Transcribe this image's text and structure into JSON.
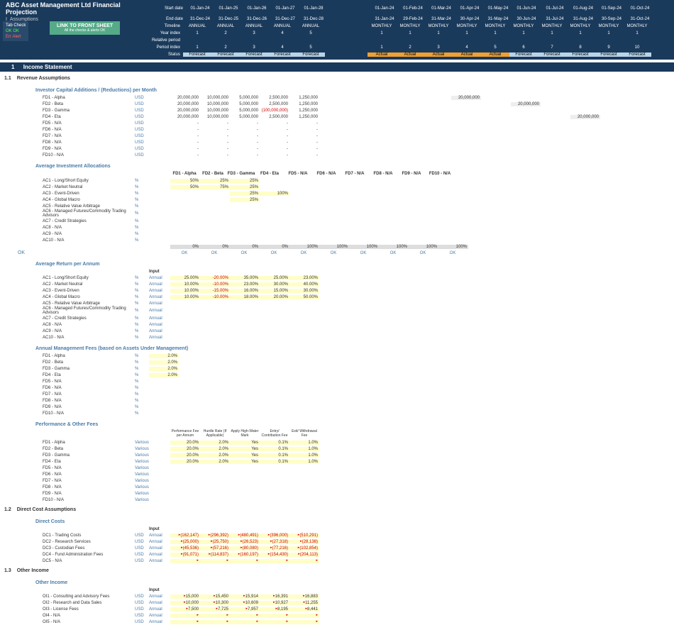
{
  "header": {
    "title": "ABC Asset Management Ltd Financial Projection",
    "subtitle": "I_Assumptions",
    "rows": [
      {
        "label": "Start date",
        "annual": [
          "01-Jan-24",
          "01-Jan-25",
          "01-Jan-26",
          "01-Jan-27",
          "01-Jan-28"
        ],
        "monthly": [
          "01-Jan-24",
          "01-Feb-24",
          "01-Mar-24",
          "01-Apr-24",
          "01-May-24",
          "01-Jun-24",
          "01-Jul-24",
          "01-Aug-24",
          "01-Sep-24",
          "01-Oct-24"
        ]
      },
      {
        "label": "End date",
        "annual": [
          "31-Dec-24",
          "31-Dec-25",
          "31-Dec-26",
          "31-Dec-27",
          "31-Dec-28"
        ],
        "monthly": [
          "31-Jan-24",
          "29-Feb-24",
          "31-Mar-24",
          "30-Apr-24",
          "31-May-24",
          "30-Jun-24",
          "31-Jul-24",
          "31-Aug-24",
          "30-Sep-24",
          "31-Oct-24"
        ]
      },
      {
        "label": "Timeline",
        "annual": [
          "ANNUAL",
          "ANNUAL",
          "ANNUAL",
          "ANNUAL",
          "ANNUAL"
        ],
        "monthly": [
          "MONTHLY",
          "MONTHLY",
          "MONTHLY",
          "MONTHLY",
          "MONTHLY",
          "MONTHLY",
          "MONTHLY",
          "MONTHLY",
          "MONTHLY",
          "MONTHLY"
        ]
      },
      {
        "label": "Year index",
        "annual": [
          "1",
          "2",
          "3",
          "4",
          "5"
        ],
        "monthly": [
          "1",
          "1",
          "1",
          "1",
          "1",
          "1",
          "1",
          "1",
          "1",
          "1"
        ]
      },
      {
        "label": "Relative period",
        "annual": [
          "",
          "",
          "",
          "",
          ""
        ],
        "monthly": [
          "",
          "",
          "",
          "",
          "",
          "",
          "",
          "",
          "",
          ""
        ]
      },
      {
        "label": "Period index",
        "annual": [
          "1",
          "2",
          "3",
          "4",
          "5"
        ],
        "monthly": [
          "1",
          "2",
          "3",
          "4",
          "5",
          "6",
          "7",
          "8",
          "9",
          "10"
        ]
      },
      {
        "label": "Status",
        "annual": [
          "Forecast",
          "Forecast",
          "Forecast",
          "Forecast",
          "Forecast"
        ],
        "monthly": [
          "Actual",
          "Actual",
          "Actual",
          "Actual",
          "Actual",
          "Forecast",
          "Forecast",
          "Forecast",
          "Forecast",
          "Forecast"
        ],
        "status": true
      }
    ]
  },
  "tabcheck": {
    "title": "Tab Check",
    "ok_lbl": "OK",
    "ok_val": "OK",
    "err_lbl": "Err",
    "err_val": "Alert"
  },
  "linkbtn": {
    "main": "LINK TO FRONT SHEET",
    "sub": "All the checks & alerts OK"
  },
  "sec1": {
    "num": "1",
    "title": "Income Statement"
  },
  "sec11": {
    "num": "1.1",
    "title": "Revenue Assumptions"
  },
  "grp_invcap": {
    "title": "Investor Capital Additions / (Reductions) per Month"
  },
  "invcap_rows": [
    {
      "lbl": "FD1 - Alpha",
      "u": "USD",
      "v": [
        "20,000,000",
        "10,000,000",
        "5,000,000",
        "2,500,000",
        "1,250,000"
      ],
      "m": [
        3,
        "20,000,000"
      ]
    },
    {
      "lbl": "FD2 - Beta",
      "u": "USD",
      "v": [
        "20,000,000",
        "10,000,000",
        "5,000,000",
        "2,500,000",
        "1,250,000"
      ],
      "m": [
        5,
        "20,000,000"
      ]
    },
    {
      "lbl": "FD3 - Gamma",
      "u": "USD",
      "v": [
        "20,000,000",
        "10,000,000",
        "5,000,000",
        "(100,000,000)",
        "1,250,000"
      ],
      "neg": 3,
      "m": null
    },
    {
      "lbl": "FD4 - Eta",
      "u": "USD",
      "v": [
        "20,000,000",
        "10,000,000",
        "5,000,000",
        "2,500,000",
        "1,250,000"
      ],
      "m": [
        7,
        "20,000,000"
      ]
    },
    {
      "lbl": "FD5 - N/A",
      "u": "USD",
      "v": [
        "-",
        "-",
        "-",
        "-",
        "-"
      ]
    },
    {
      "lbl": "FD6 - N/A",
      "u": "USD",
      "v": [
        "-",
        "-",
        "-",
        "-",
        "-"
      ]
    },
    {
      "lbl": "FD7 - N/A",
      "u": "USD",
      "v": [
        "-",
        "-",
        "-",
        "-",
        "-"
      ]
    },
    {
      "lbl": "FD8 - N/A",
      "u": "USD",
      "v": [
        "-",
        "-",
        "-",
        "-",
        "-"
      ]
    },
    {
      "lbl": "FD9 - N/A",
      "u": "USD",
      "v": [
        "-",
        "-",
        "-",
        "-",
        "-"
      ]
    },
    {
      "lbl": "FD10 - N/A",
      "u": "USD",
      "v": [
        "-",
        "-",
        "-",
        "-",
        "-"
      ]
    }
  ],
  "grp_alloc": {
    "title": "Average Investment Allocations",
    "cols": [
      "FD1 - Alpha",
      "FD2 - Beta",
      "FD3 - Gamma",
      "FD4 - Eta",
      "FD5 - N/A",
      "FD6 - N/A",
      "FD7 - N/A",
      "FD8 - N/A",
      "FD9 - N/A",
      "FD10 - N/A"
    ]
  },
  "alloc_rows": [
    {
      "lbl": "AC1 - Long/Short Equity",
      "u": "%",
      "v": [
        "50%",
        "25%",
        "25%",
        "",
        "",
        "",
        "",
        "",
        "",
        ""
      ]
    },
    {
      "lbl": "AC2 - Market Neutral",
      "u": "%",
      "v": [
        "50%",
        "75%",
        "25%",
        "",
        "",
        "",
        "",
        "",
        "",
        ""
      ]
    },
    {
      "lbl": "AC3 - Event-Driven",
      "u": "%",
      "v": [
        "",
        "",
        "25%",
        "100%",
        "",
        "",
        "",
        "",
        "",
        ""
      ]
    },
    {
      "lbl": "AC4 - Global Macro",
      "u": "%",
      "v": [
        "",
        "",
        "25%",
        "",
        "",
        "",
        "",
        "",
        "",
        ""
      ]
    },
    {
      "lbl": "AC5 - Relative Value Arbitrage",
      "u": "%",
      "v": [
        "",
        "",
        "",
        "",
        "",
        "",
        "",
        "",
        "",
        ""
      ]
    },
    {
      "lbl": "AC6 - Managed Futures/Commodity Trading Advisors",
      "u": "%",
      "v": [
        "",
        "",
        "",
        "",
        "",
        "",
        "",
        "",
        "",
        ""
      ]
    },
    {
      "lbl": "AC7 - Credit Strategies",
      "u": "%",
      "v": [
        "",
        "",
        "",
        "",
        "",
        "",
        "",
        "",
        "",
        ""
      ]
    },
    {
      "lbl": "AC8 - N/A",
      "u": "%",
      "v": [
        "",
        "",
        "",
        "",
        "",
        "",
        "",
        "",
        "",
        ""
      ]
    },
    {
      "lbl": "AC9 - N/A",
      "u": "%",
      "v": [
        "",
        "",
        "",
        "",
        "",
        "",
        "",
        "",
        "",
        ""
      ]
    },
    {
      "lbl": "AC10 - N/A",
      "u": "%",
      "v": [
        "",
        "",
        "",
        "",
        "",
        "",
        "",
        "",
        "",
        ""
      ]
    }
  ],
  "alloc_total": [
    "0%",
    "0%",
    "0%",
    "0%",
    "100%",
    "100%",
    "100%",
    "100%",
    "100%",
    "100%"
  ],
  "alloc_ok": [
    "OK",
    "OK",
    "OK",
    "OK",
    "OK",
    "OK",
    "OK",
    "OK",
    "OK",
    "OK"
  ],
  "ok_side": "OK",
  "grp_ret": {
    "title": "Average Return per Annum",
    "input": "Input"
  },
  "ret_rows": [
    {
      "lbl": "AC1 - Long/Short Equity",
      "u": "%",
      "s": "Annual",
      "v": [
        "25.00%",
        "-20.00%",
        "35.00%",
        "25.00%",
        "23.00%"
      ],
      "neg": [
        1
      ]
    },
    {
      "lbl": "AC2 - Market Neutral",
      "u": "%",
      "s": "Annual",
      "v": [
        "10.00%",
        "-10.00%",
        "23.00%",
        "30.00%",
        "40.00%"
      ],
      "neg": [
        1
      ]
    },
    {
      "lbl": "AC3 - Event-Driven",
      "u": "%",
      "s": "Annual",
      "v": [
        "10.00%",
        "-15.00%",
        "16.00%",
        "15.00%",
        "30.00%"
      ],
      "neg": [
        1
      ]
    },
    {
      "lbl": "AC4 - Global Macro",
      "u": "%",
      "s": "Annual",
      "v": [
        "10.00%",
        "-10.00%",
        "18.00%",
        "20.00%",
        "50.00%"
      ],
      "neg": [
        1
      ]
    },
    {
      "lbl": "AC5 - Relative Value Arbitrage",
      "u": "%",
      "s": "Annual",
      "v": [
        "",
        "",
        "",
        "",
        ""
      ]
    },
    {
      "lbl": "AC6 - Managed Futures/Commodity Trading Advisors",
      "u": "%",
      "s": "Annual",
      "v": [
        "",
        "",
        "",
        "",
        ""
      ]
    },
    {
      "lbl": "AC7 - Credit Strategies",
      "u": "%",
      "s": "Annual",
      "v": [
        "",
        "",
        "",
        "",
        ""
      ]
    },
    {
      "lbl": "AC8 - N/A",
      "u": "%",
      "s": "Annual",
      "v": [
        "",
        "",
        "",
        "",
        ""
      ]
    },
    {
      "lbl": "AC9 - N/A",
      "u": "%",
      "s": "Annual",
      "v": [
        "",
        "",
        "",
        "",
        ""
      ]
    },
    {
      "lbl": "AC10 - N/A",
      "u": "%",
      "s": "Annual",
      "v": [
        "",
        "",
        "",
        "",
        ""
      ]
    }
  ],
  "grp_mgmt": {
    "title": "Annual Management Fees (based on Assets Under Management)"
  },
  "mgmt_rows": [
    {
      "lbl": "FD1 - Alpha",
      "u": "%",
      "v": "2.0%"
    },
    {
      "lbl": "FD2 - Beta",
      "u": "%",
      "v": "2.0%"
    },
    {
      "lbl": "FD3 - Gamma",
      "u": "%",
      "v": "2.0%"
    },
    {
      "lbl": "FD4 - Eta",
      "u": "%",
      "v": "2.0%"
    },
    {
      "lbl": "FD5 - N/A",
      "u": "%",
      "v": ""
    },
    {
      "lbl": "FD6 - N/A",
      "u": "%",
      "v": ""
    },
    {
      "lbl": "FD7 - N/A",
      "u": "%",
      "v": ""
    },
    {
      "lbl": "FD8 - N/A",
      "u": "%",
      "v": ""
    },
    {
      "lbl": "FD9 - N/A",
      "u": "%",
      "v": ""
    },
    {
      "lbl": "FD10 - N/A",
      "u": "%",
      "v": ""
    }
  ],
  "grp_perf": {
    "title": "Performance & Other Fees",
    "cols": [
      "Performance Fee per Annum",
      "Hurdle Rate (If Applicable)",
      "Apply High-Water Mark",
      "Entry/ Contribution Fee",
      "Exit/ Withdrawal Fee"
    ]
  },
  "perf_rows": [
    {
      "lbl": "FD1 - Alpha",
      "u": "Various",
      "v": [
        "20.0%",
        "2.0%",
        "Yes",
        "0.1%",
        "1.0%"
      ]
    },
    {
      "lbl": "FD2 - Beta",
      "u": "Various",
      "v": [
        "20.0%",
        "2.0%",
        "Yes",
        "0.1%",
        "1.0%"
      ]
    },
    {
      "lbl": "FD3 - Gamma",
      "u": "Various",
      "v": [
        "20.0%",
        "2.0%",
        "Yes",
        "0.1%",
        "1.0%"
      ]
    },
    {
      "lbl": "FD4 - Eta",
      "u": "Various",
      "v": [
        "20.0%",
        "2.0%",
        "Yes",
        "0.1%",
        "1.0%"
      ]
    },
    {
      "lbl": "FD5 - N/A",
      "u": "Various",
      "v": [
        "",
        "",
        "",
        "",
        ""
      ]
    },
    {
      "lbl": "FD6 - N/A",
      "u": "Various",
      "v": [
        "",
        "",
        "",
        "",
        ""
      ]
    },
    {
      "lbl": "FD7 - N/A",
      "u": "Various",
      "v": [
        "",
        "",
        "",
        "",
        ""
      ]
    },
    {
      "lbl": "FD8 - N/A",
      "u": "Various",
      "v": [
        "",
        "",
        "",
        "",
        ""
      ]
    },
    {
      "lbl": "FD9 - N/A",
      "u": "Various",
      "v": [
        "",
        "",
        "",
        "",
        ""
      ]
    },
    {
      "lbl": "FD10 - N/A",
      "u": "Various",
      "v": [
        "",
        "",
        "",
        "",
        ""
      ]
    }
  ],
  "sec12": {
    "num": "1.2",
    "title": "Direct Cost Assumptions"
  },
  "grp_dc": {
    "title": "Direct Costs",
    "input": "Input"
  },
  "dc_rows": [
    {
      "lbl": "DC1 - Trading Costs",
      "u": "USD",
      "s": "Annual",
      "v": [
        "(162,147)",
        "(296,392)",
        "(480,491)",
        "(396,000)",
        "(510,291)"
      ]
    },
    {
      "lbl": "DC2 - Research Services",
      "u": "USD",
      "s": "Annual",
      "v": [
        "(25,000)",
        "(25,750)",
        "(26,523)",
        "(27,318)",
        "(28,138)"
      ]
    },
    {
      "lbl": "DC3 - Custodian Fees",
      "u": "USD",
      "s": "Annual",
      "v": [
        "(45,536)",
        "(57,216)",
        "(80,080)",
        "(77,216)",
        "(102,854)"
      ]
    },
    {
      "lbl": "DC4 - Fund Administration Fees",
      "u": "USD",
      "s": "Annual",
      "v": [
        "(91,071)",
        "(114,837)",
        "(160,197)",
        "(154,430)",
        "(204,113)"
      ]
    },
    {
      "lbl": "DC5 - N/A",
      "u": "USD",
      "s": "Annual",
      "v": [
        "",
        "",
        "",
        "",
        ""
      ]
    }
  ],
  "sec13": {
    "num": "1.3",
    "title": "Other Income"
  },
  "grp_oi": {
    "title": "Other Income",
    "input": "Input"
  },
  "oi_rows": [
    {
      "lbl": "OI1 - Consulting and Advisory Fees",
      "u": "USD",
      "s": "Annual",
      "v": [
        "15,000",
        "15,450",
        "15,914",
        "16,391",
        "16,883"
      ]
    },
    {
      "lbl": "OI2 - Research and Data Sales",
      "u": "USD",
      "s": "Annual",
      "v": [
        "10,000",
        "10,300",
        "10,609",
        "10,927",
        "11,255"
      ]
    },
    {
      "lbl": "OI3 - License Fees",
      "u": "USD",
      "s": "Annual",
      "v": [
        "7,500",
        "7,725",
        "7,957",
        "8,195",
        "8,441"
      ]
    },
    {
      "lbl": "OI4 - N/A",
      "u": "USD",
      "s": "Annual",
      "v": [
        "",
        "",
        "",
        "",
        ""
      ]
    },
    {
      "lbl": "OI5 - N/A",
      "u": "USD",
      "s": "Annual",
      "v": [
        "",
        "",
        "",
        "",
        ""
      ]
    }
  ]
}
